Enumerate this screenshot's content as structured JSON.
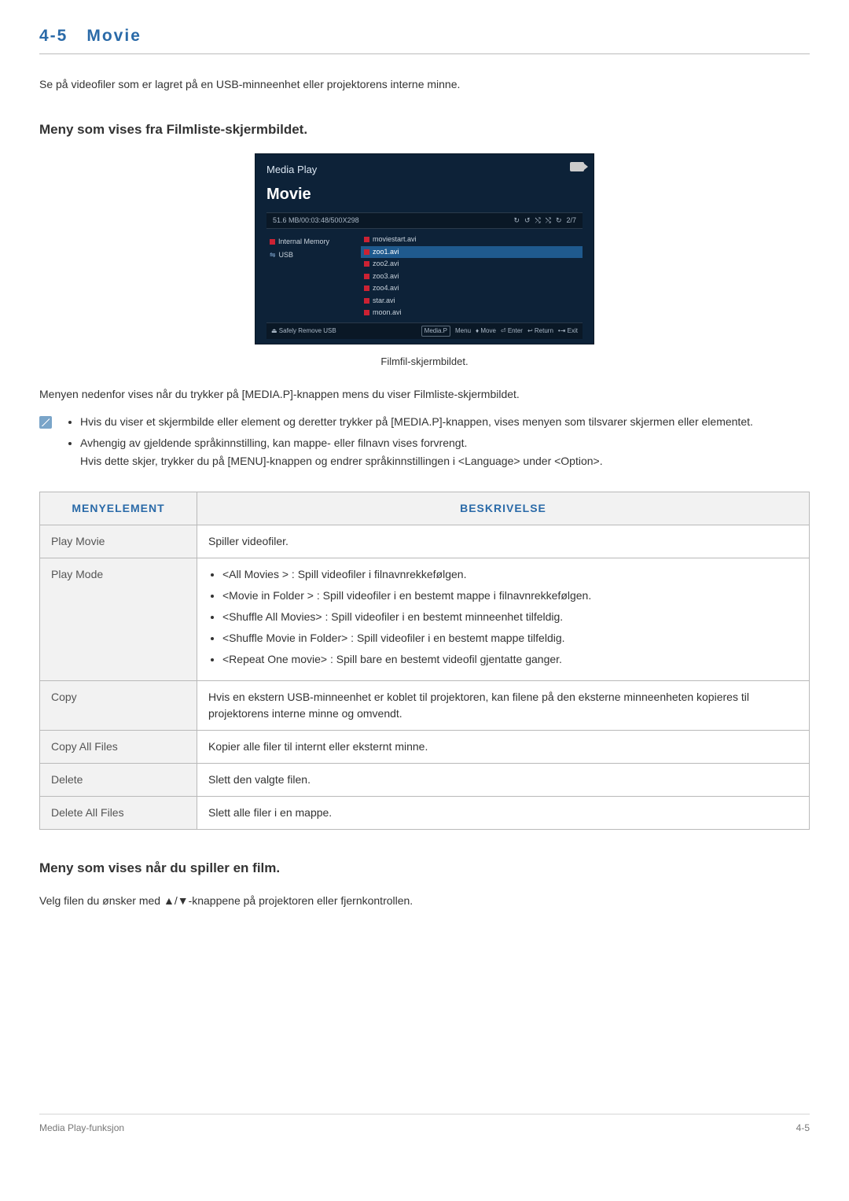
{
  "section": {
    "number": "4-5",
    "title": "Movie"
  },
  "intro": "Se på videofiler som er lagret på en USB-minneenhet eller projektorens interne minne.",
  "sub1": "Meny som vises fra Filmliste-skjermbildet.",
  "media": {
    "title": "Media Play",
    "subtitle": "Movie",
    "status_left": "51.6 MB/00:03:48/500X298",
    "status_right": "2/7",
    "side_internal": "Internal Memory",
    "side_usb": "USB",
    "files": [
      "moviestart.avi",
      "zoo1.avi",
      "zoo2.avi",
      "zoo3.avi",
      "zoo4.avi",
      "star.avi",
      "moon.avi"
    ],
    "foot_safely": "Safely Remove USB",
    "foot_mediap": "Media.P",
    "foot_menu": "Menu",
    "foot_move": "Move",
    "foot_enter": "Enter",
    "foot_return": "Return",
    "foot_exit": "Exit"
  },
  "caption": "Filmfil-skjermbildet.",
  "para_menu": "Menyen nedenfor vises når du trykker på [MEDIA.P]-knappen mens du viser Filmliste-skjermbildet.",
  "notes": {
    "n1": "Hvis du viser et skjermbilde eller element og deretter trykker på [MEDIA.P]-knappen, vises menyen som tilsvarer skjermen eller elementet.",
    "n2a": "Avhengig av gjeldende språkinnstilling, kan mappe- eller filnavn vises forvrengt.",
    "n2b": "Hvis dette skjer, trykker du på [MENU]-knappen og endrer språkinnstillingen i <Language> under <Option>."
  },
  "table": {
    "h1": "MENYELEMENT",
    "h2": "BESKRIVELSE",
    "rows": [
      {
        "c1": "Play Movie",
        "c2": "Spiller videofiler."
      },
      {
        "c1": "Play Mode",
        "list": [
          "<All Movies > : Spill videofiler i filnavnrekkefølgen.",
          "<Movie in Folder > : Spill videofiler i en bestemt mappe i filnavnrekkefølgen.",
          "<Shuffle All Movies> : Spill videofiler i en bestemt minneenhet tilfeldig.",
          "<Shuffle Movie in Folder> : Spill videofiler i en bestemt mappe tilfeldig.",
          "<Repeat One movie> : Spill bare en bestemt videofil gjentatte ganger."
        ]
      },
      {
        "c1": "Copy",
        "c2": "Hvis en ekstern USB-minneenhet er koblet til projektoren, kan filene på den eksterne minneenheten kopieres til projektorens interne minne og omvendt."
      },
      {
        "c1": "Copy All Files",
        "c2": "Kopier alle filer til internt eller eksternt minne."
      },
      {
        "c1": "Delete",
        "c2": "Slett den valgte filen."
      },
      {
        "c1": "Delete All Files",
        "c2": "Slett alle filer i en mappe."
      }
    ]
  },
  "sub2": "Meny som vises når du spiller en film.",
  "para2": "Velg filen du ønsker med ▲/▼-knappene på projektoren eller fjernkontrollen.",
  "footer": {
    "left": "Media Play-funksjon",
    "right": "4-5"
  }
}
